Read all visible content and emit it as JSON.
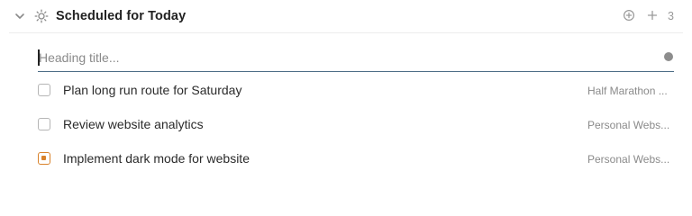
{
  "section": {
    "title": "Scheduled for Today",
    "count": "3",
    "collapse_icon": "chevron-down-icon",
    "section_icon": "sun-icon",
    "actions": [
      "add-circle-icon",
      "plus-icon"
    ]
  },
  "heading_input": {
    "placeholder": "Heading title...",
    "value": ""
  },
  "tasks": [
    {
      "label": "Plan long run route for Saturday",
      "project": "Half Marathon ...",
      "state": "unchecked"
    },
    {
      "label": "Review website analytics",
      "project": "Personal Webs...",
      "state": "unchecked"
    },
    {
      "label": "Implement dark mode for website",
      "project": "Personal Webs...",
      "state": "in-progress"
    }
  ],
  "colors": {
    "accent_orange": "#d9822b",
    "input_underline": "#4d6d86",
    "muted_text": "#8a8a8a"
  }
}
